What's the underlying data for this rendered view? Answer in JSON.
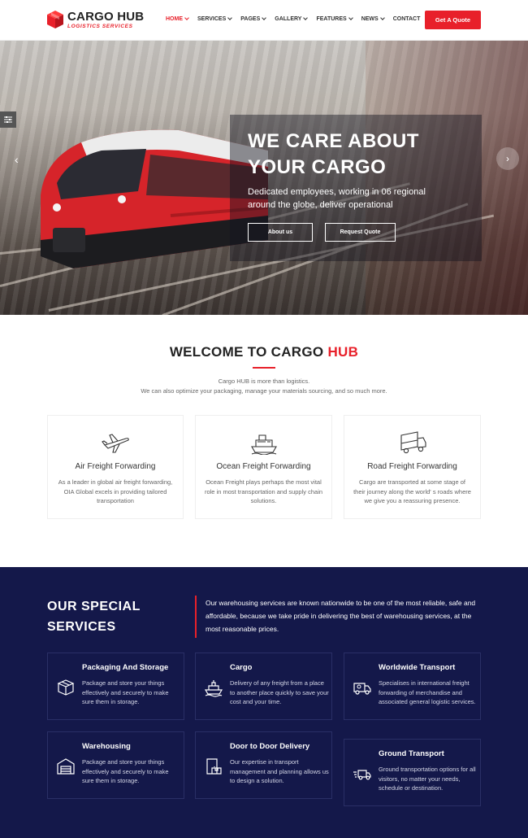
{
  "brand": {
    "name": "CARGO HUB",
    "tagline": "LOGISTICS SERVICES",
    "accent_color": "#e8202a",
    "navy_color": "#14184a"
  },
  "nav": {
    "items": [
      {
        "label": "HOME",
        "active": true,
        "dropdown": true
      },
      {
        "label": "SERVICES",
        "active": false,
        "dropdown": true
      },
      {
        "label": "PAGES",
        "active": false,
        "dropdown": true
      },
      {
        "label": "GALLERY",
        "active": false,
        "dropdown": true
      },
      {
        "label": "FEATURES",
        "active": false,
        "dropdown": true
      },
      {
        "label": "NEWS",
        "active": false,
        "dropdown": true
      },
      {
        "label": "CONTACT",
        "active": false,
        "dropdown": false
      }
    ],
    "cta_label": "Get A Quote"
  },
  "hero": {
    "title_line1": "WE CARE ABOUT",
    "title_line2": "YOUR CARGO",
    "text_line1": "Dedicated employees, working in 06 regional",
    "text_line2": "around the globe, deliver operational",
    "btn_about": "About us",
    "btn_quote": "Request Quote",
    "prev_icon": "chevron-left-icon",
    "next_icon": "chevron-right-icon"
  },
  "welcome": {
    "title_main": "WELCOME TO CARGO ",
    "title_accent": "HUB",
    "text_line1": "Cargo HUB is more than logistics.",
    "text_line2": "We can also optimize your packaging, manage your materials sourcing, and so much more.",
    "features": [
      {
        "icon": "airplane-icon",
        "title": "Air Freight Forwarding",
        "desc": "As a leader in global air freight forwarding, OIA Global excels in providing tailored transportation"
      },
      {
        "icon": "ship-icon",
        "title": "Ocean Freight Forwarding",
        "desc": "Ocean Freight plays perhaps the most vital role in most transportation and supply chain solutions."
      },
      {
        "icon": "truck-icon",
        "title": "Road Freight Forwarding",
        "desc": "Cargo are transported at some stage of their journey along the world' s roads where we give you a reassuring presence."
      }
    ]
  },
  "services": {
    "heading_line1": "OUR SPECIAL",
    "heading_line2": "SERVICES",
    "intro": "Our warehousing services are known nationwide to be one of the most reliable, safe and affordable, because we take pride in delivering the best of warehousing services, at the most reasonable prices.",
    "cards": [
      {
        "icon": "package-icon",
        "title": "Packaging And Storage",
        "desc": "Package and store your things effectively and securely to make sure them in storage."
      },
      {
        "icon": "cargo-ship-icon",
        "title": "Cargo",
        "desc": "Delivery of any freight from a place to another place quickly to save your cost and your time."
      },
      {
        "icon": "delivery-van-icon",
        "title": "Worldwide Transport",
        "desc": "Specialises in international freight forwarding of merchandise and associated general logistic services."
      },
      {
        "icon": "warehouse-icon",
        "title": "Warehousing",
        "desc": "Package and store your things effectively and securely to make sure them in storage."
      },
      {
        "icon": "door-delivery-icon",
        "title": "Door to Door Delivery",
        "desc": "Our expertise in transport management and planning allows us to design a solution."
      },
      {
        "icon": "fast-truck-icon",
        "title": "Ground Transport",
        "desc": "Ground transportation options for all visitors, no matter your needs, schedule or destination."
      }
    ]
  }
}
